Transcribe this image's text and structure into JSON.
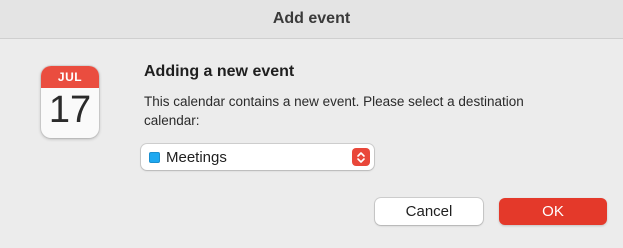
{
  "window": {
    "title": "Add event"
  },
  "icon": {
    "month": "JUL",
    "day": "17"
  },
  "dialog": {
    "heading": "Adding a new event",
    "message": "This calendar contains a new event. Please select a destination calendar:"
  },
  "calendar_select": {
    "selected": "Meetings",
    "swatch_color": "#1ea8f0",
    "icon": "up-down-chevron-icon"
  },
  "buttons": {
    "cancel_label": "Cancel",
    "ok_label": "OK"
  },
  "colors": {
    "accent": "#e4392a",
    "calendar_header": "#ea4d3f"
  }
}
